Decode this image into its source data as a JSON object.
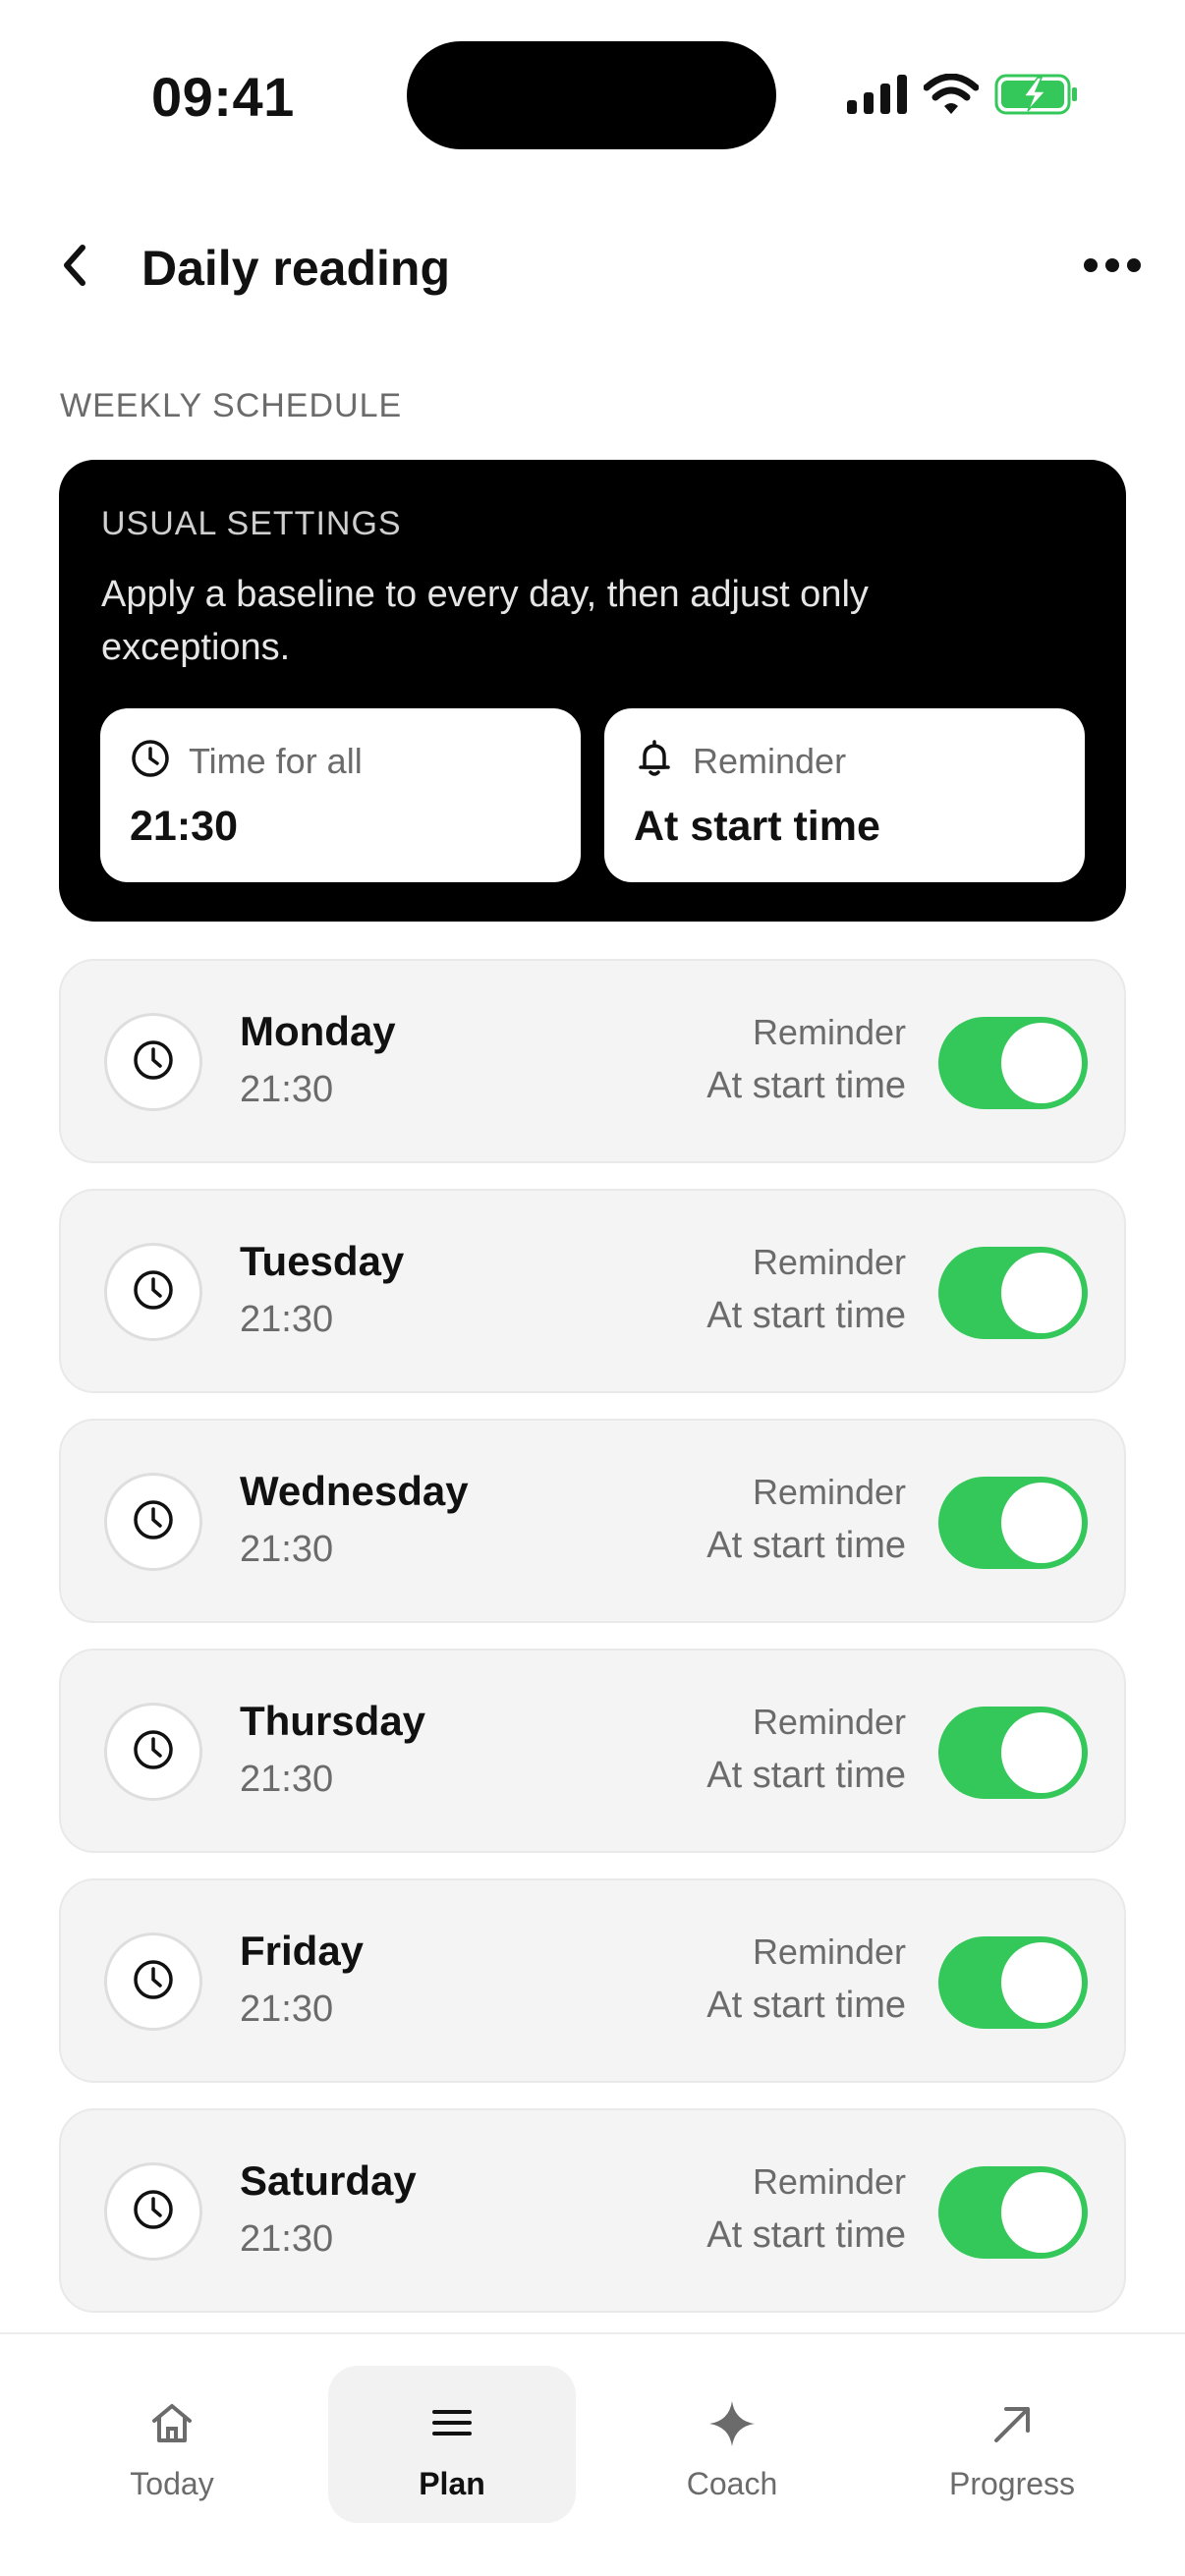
{
  "status_bar": {
    "time": "09:41",
    "icons": [
      "signal-icon",
      "wifi-icon",
      "battery-charging-icon"
    ],
    "battery_color": "#34c759"
  },
  "header": {
    "title": "Daily reading",
    "back_icon": "chevron-left-icon",
    "more_icon": "more-horizontal-icon"
  },
  "section": {
    "label": "WEEKLY SCHEDULE"
  },
  "usual": {
    "title": "USUAL SETTINGS",
    "description": "Apply a baseline to every day, then adjust only exceptions.",
    "time_tile": {
      "label": "Time for all",
      "value": "21:30",
      "icon": "clock-icon"
    },
    "reminder_tile": {
      "label": "Reminder",
      "value": "At start time",
      "icon": "bell-icon"
    }
  },
  "days": [
    {
      "name": "Monday",
      "time": "21:30",
      "reminder_label": "Reminder",
      "reminder_value": "At start time",
      "enabled": true
    },
    {
      "name": "Tuesday",
      "time": "21:30",
      "reminder_label": "Reminder",
      "reminder_value": "At start time",
      "enabled": true
    },
    {
      "name": "Wednesday",
      "time": "21:30",
      "reminder_label": "Reminder",
      "reminder_value": "At start time",
      "enabled": true
    },
    {
      "name": "Thursday",
      "time": "21:30",
      "reminder_label": "Reminder",
      "reminder_value": "At start time",
      "enabled": true
    },
    {
      "name": "Friday",
      "time": "21:30",
      "reminder_label": "Reminder",
      "reminder_value": "At start time",
      "enabled": true
    },
    {
      "name": "Saturday",
      "time": "21:30",
      "reminder_label": "Reminder",
      "reminder_value": "At start time",
      "enabled": true
    }
  ],
  "tabs": [
    {
      "label": "Today",
      "icon": "home-icon",
      "active": false
    },
    {
      "label": "Plan",
      "icon": "menu-icon",
      "active": true
    },
    {
      "label": "Coach",
      "icon": "sparkle-icon",
      "active": false
    },
    {
      "label": "Progress",
      "icon": "arrow-up-right-icon",
      "active": false
    }
  ],
  "colors": {
    "accent_toggle": "#34c759",
    "card_dark": "#000000",
    "row_bg": "#f4f4f4",
    "muted_text": "#6b6b6b"
  }
}
